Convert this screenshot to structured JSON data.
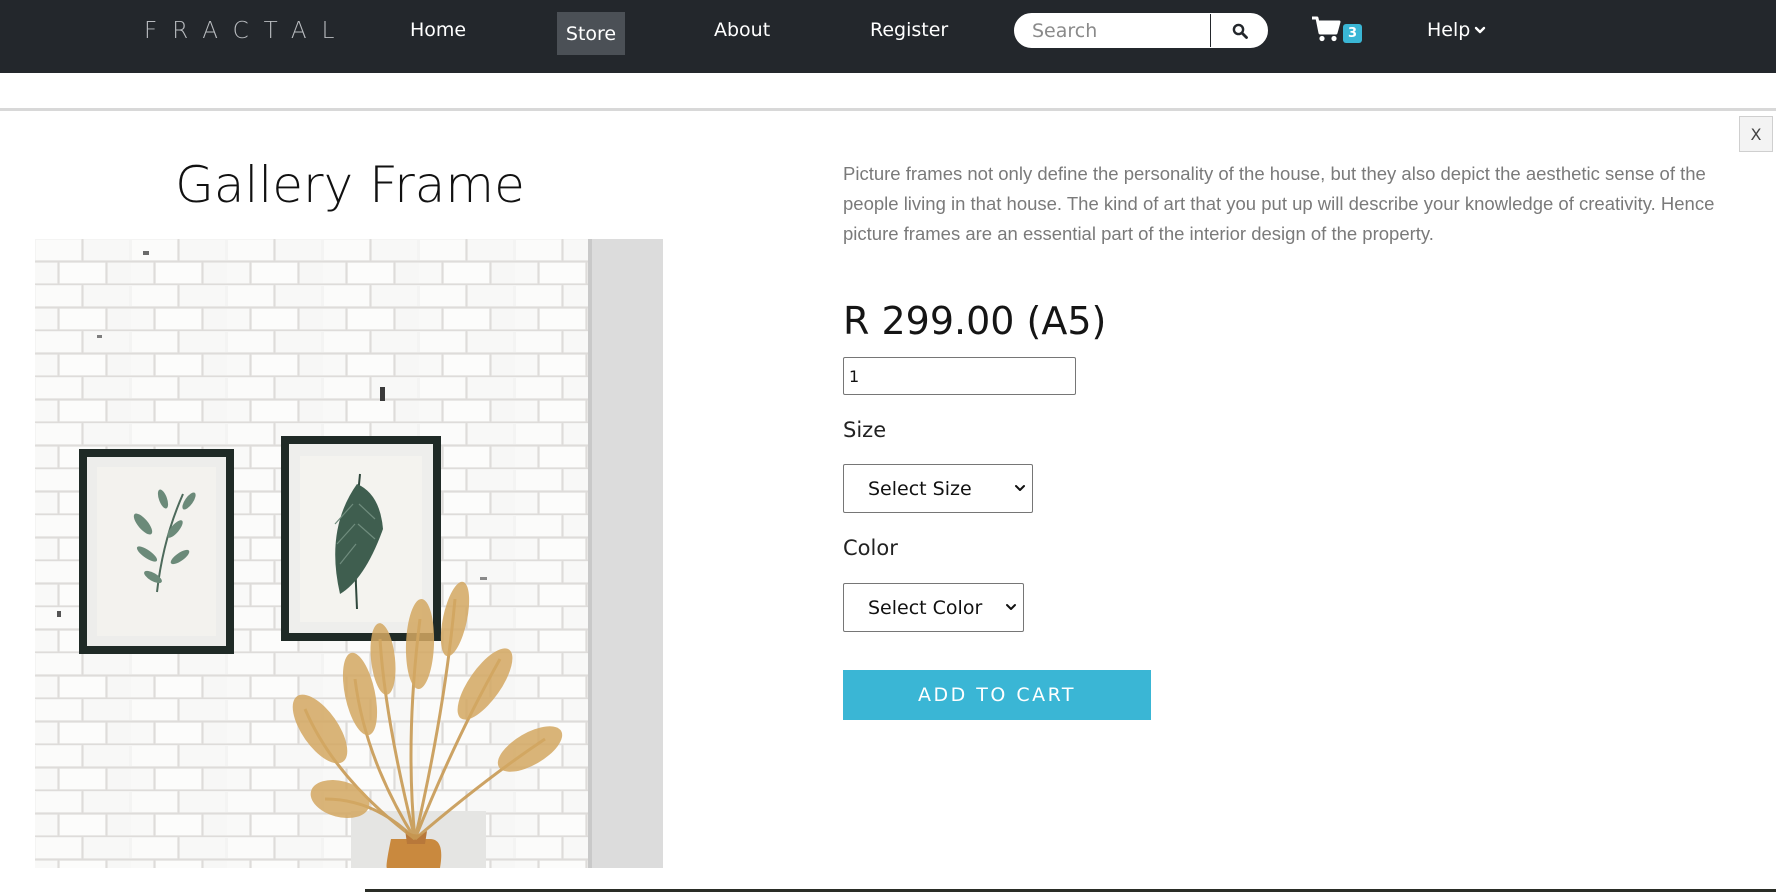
{
  "navbar": {
    "brand": "FRACTAL",
    "links": {
      "home": "Home",
      "store": "Store",
      "about": "About",
      "register": "Register"
    },
    "search": {
      "placeholder": "Search",
      "icon": "search-icon"
    },
    "cart": {
      "icon": "cart-icon",
      "count": "3"
    },
    "help": {
      "label": "Help",
      "icon": "chevron-down-icon"
    },
    "active_link": "Store",
    "colors": {
      "bar": "#23272c",
      "active_bg": "#4b5056",
      "badge": "#3ab6d5"
    }
  },
  "modal": {
    "close_label": "X",
    "product": {
      "title": "Gallery Frame",
      "image_alt": "Two framed botanical prints on a white brick wall with dried pampas grass in a vase",
      "description": "Picture frames not only define the personality of the house, but they also depict the aesthetic sense of the people living in that house. The kind of art that you put up will describe your knowledge of creativity. Hence picture frames are an essential part of the interior design of the property.",
      "price": "R 299.00 (A5)",
      "quantity": "1",
      "size_label": "Size",
      "size_select": "Select Size",
      "color_label": "Color",
      "color_select": "Select Color",
      "add_to_cart": "ADD TO CART"
    },
    "colors": {
      "button": "#3ab6d5"
    }
  }
}
